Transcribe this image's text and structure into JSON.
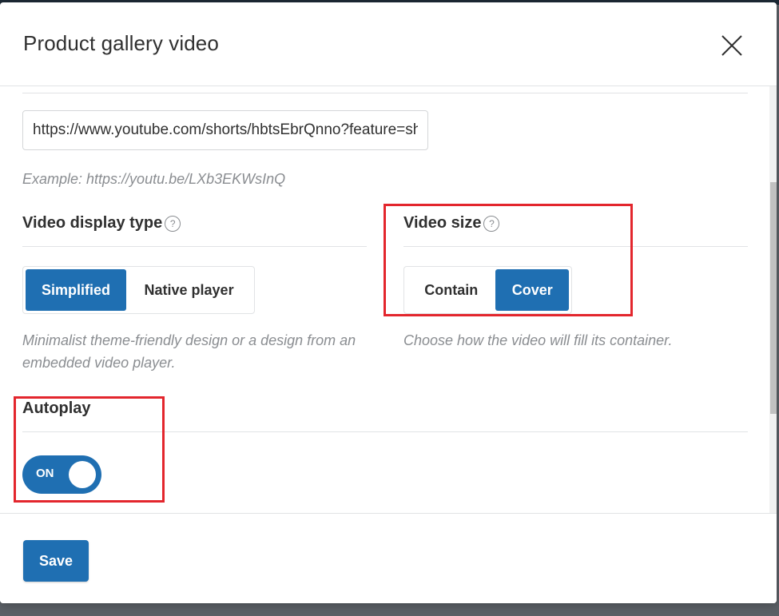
{
  "modal": {
    "title": "Product gallery video"
  },
  "video_url": {
    "value": "https://www.youtube.com/shorts/hbtsEbrQnno?feature=share",
    "hint": "Example: https://youtu.be/LXb3EKWsInQ"
  },
  "display_type": {
    "label": "Video display type",
    "help": "?",
    "options": [
      "Simplified",
      "Native player"
    ],
    "selected": "Simplified",
    "hint": "Minimalist theme-friendly design or a design from an embedded video player."
  },
  "video_size": {
    "label": "Video size",
    "help": "?",
    "options": [
      "Contain",
      "Cover"
    ],
    "selected": "Cover",
    "hint": "Choose how the video will fill its container."
  },
  "autoplay": {
    "label": "Autoplay",
    "state": "ON",
    "enabled": true
  },
  "footer": {
    "save_label": "Save"
  },
  "colors": {
    "accent": "#1f6fb2",
    "highlight": "#e3262d"
  },
  "icons": {
    "close": "close-icon",
    "help": "help-icon"
  }
}
